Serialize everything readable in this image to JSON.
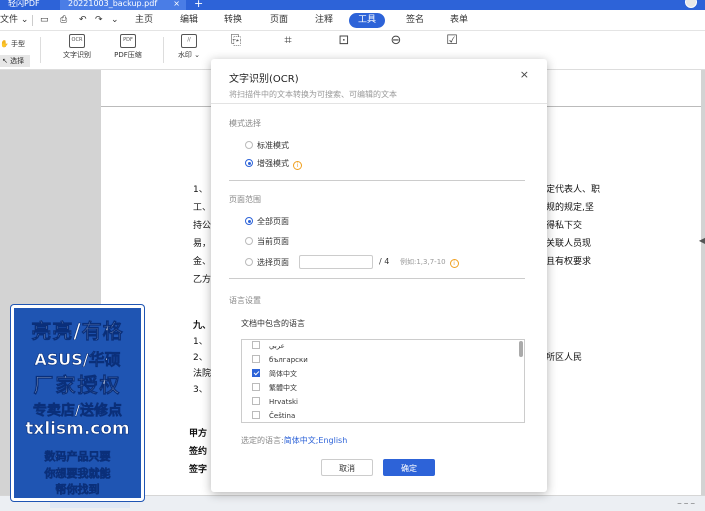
{
  "tabs": {
    "app": "轻闪PDF",
    "doc": "20221003_backup.pdf",
    "close": "×",
    "add": "+"
  },
  "menubar": {
    "file": "文件",
    "items": [
      "主页",
      "编辑",
      "转换",
      "页面",
      "注释",
      "工具",
      "签名",
      "表单"
    ],
    "active": "工具",
    "chevron": "⌄"
  },
  "ribbon": {
    "hand": "手型",
    "select": "选择",
    "ocr_icon": "OCR",
    "ocr": "文字识别",
    "compress_icon": "PDF",
    "compress": "PDF压缩",
    "watermark": "水印"
  },
  "document": {
    "lines_left": [
      "1、",
      "工、",
      "持公",
      "易，",
      "金、",
      "乙方"
    ],
    "lines_right": [
      "定代表人、职",
      "规的规定,坚",
      "得私下交",
      "关联人员现",
      "且有权要求"
    ],
    "section": [
      "九、",
      "1、",
      "2、",
      "法院",
      "3、"
    ],
    "section_right": "所区人民",
    "sign": [
      "甲方",
      "签约",
      "签字"
    ]
  },
  "promo": {
    "line1": "亮亮/有格",
    "line2": "ASUS/华硕",
    "line3": "厂家授权",
    "line4": "专卖店/送修点",
    "line5": "txlism.com",
    "line6": "数码产品只要",
    "line7": "你想要我就能",
    "line8": "帮你找到"
  },
  "dialog": {
    "title": "文字识别(OCR)",
    "close": "×",
    "subtitle": "将扫描件中的文本转换为可搜索、可编辑的文本",
    "mode_section": "模式选择",
    "mode_standard": "标准模式",
    "mode_enhanced": "增强模式",
    "info_icon": "i",
    "range_section": "页面范围",
    "range_all": "全部页面",
    "range_current": "当前页面",
    "range_select": "选择页面",
    "range_of": "/ 4",
    "range_example": "例如:1,3,7-10",
    "lang_section": "语言设置",
    "lang_label": "文档中包含的语言",
    "languages": [
      {
        "name": "عربي",
        "checked": false
      },
      {
        "name": "български",
        "checked": false
      },
      {
        "name": "简体中文",
        "checked": true
      },
      {
        "name": "繁體中文",
        "checked": false
      },
      {
        "name": "Hrvatski",
        "checked": false
      },
      {
        "name": "Čeština",
        "checked": false
      }
    ],
    "chosen_label": "选定的语言:",
    "chosen_value": "简体中文;English",
    "cancel": "取消",
    "ok": "确定"
  },
  "colors": {
    "accent": "#2d63d8",
    "warning": "#f0a020",
    "promo_bg": "#1f55b3"
  }
}
